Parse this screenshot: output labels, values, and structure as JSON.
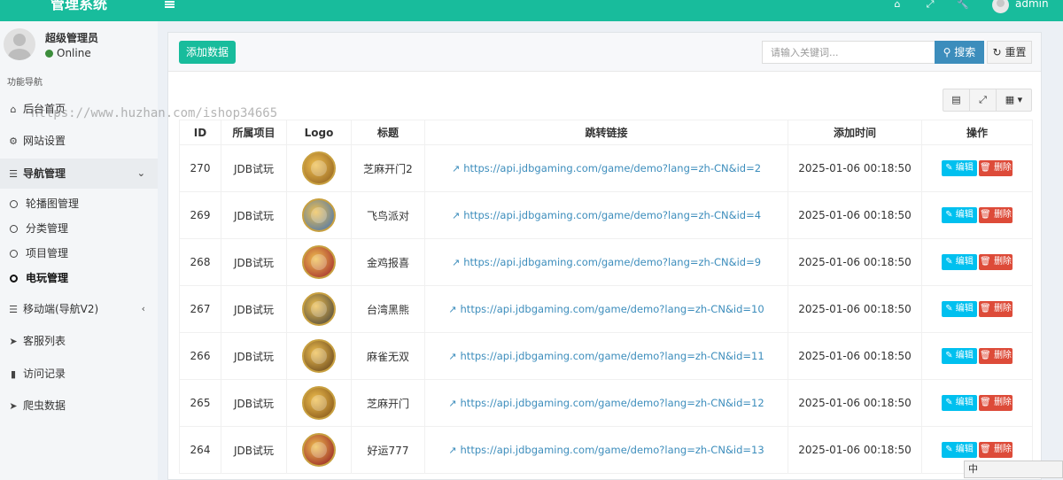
{
  "app": {
    "title": "管理系统"
  },
  "topbar": {
    "admin_name": "admin",
    "icons": [
      "home-icon",
      "expand-icon",
      "wrench-icon"
    ]
  },
  "sidebar": {
    "username": "超级管理员",
    "status": "Online",
    "section_header": "功能导航",
    "items": [
      {
        "label": "后台首页",
        "icon": "home-icon"
      },
      {
        "label": "网站设置",
        "icon": "cogs-icon"
      },
      {
        "label": "导航管理",
        "icon": "database-icon"
      },
      {
        "label": "移动端(导航V2)",
        "icon": "database-icon"
      },
      {
        "label": "客服列表",
        "icon": "tags-icon"
      },
      {
        "label": "访问记录",
        "icon": "bar-chart-icon"
      },
      {
        "label": "爬虫数据",
        "icon": "tags-icon"
      }
    ],
    "subitems": [
      "轮播图管理",
      "分类管理",
      "项目管理",
      "电玩管理"
    ]
  },
  "toolbar": {
    "add_label": "添加数据",
    "search_placeholder": "请输入关键词...",
    "search_label": "搜索",
    "reset_label": "重置"
  },
  "table": {
    "headers": [
      "ID",
      "所属项目",
      "Logo",
      "标题",
      "跳转链接",
      "添加时间",
      "操作"
    ],
    "edit_label": "编辑",
    "delete_label": "删除",
    "rows": [
      {
        "id": "270",
        "project": "JDB试玩",
        "title": "芝麻开门2",
        "link": "https://api.jdbgaming.com/game/demo?lang=zh-CN&id=2",
        "time": "2025-01-06 00:18:50",
        "logo_color": "#8a5a1c"
      },
      {
        "id": "269",
        "project": "JDB试玩",
        "title": "飞鸟派对",
        "link": "https://api.jdbgaming.com/game/demo?lang=zh-CN&id=4",
        "time": "2025-01-06 00:18:50",
        "logo_color": "#3a6fb8"
      },
      {
        "id": "268",
        "project": "JDB试玩",
        "title": "金鸡报喜",
        "link": "https://api.jdbgaming.com/game/demo?lang=zh-CN&id=9",
        "time": "2025-01-06 00:18:50",
        "logo_color": "#9c1c2a"
      },
      {
        "id": "267",
        "project": "JDB试玩",
        "title": "台湾黑熊",
        "link": "https://api.jdbgaming.com/game/demo?lang=zh-CN&id=10",
        "time": "2025-01-06 00:18:50",
        "logo_color": "#3b3b3b"
      },
      {
        "id": "266",
        "project": "JDB试玩",
        "title": "麻雀无双",
        "link": "https://api.jdbgaming.com/game/demo?lang=zh-CN&id=11",
        "time": "2025-01-06 00:18:50",
        "logo_color": "#5a3a18"
      },
      {
        "id": "265",
        "project": "JDB试玩",
        "title": "芝麻开门",
        "link": "https://api.jdbgaming.com/game/demo?lang=zh-CN&id=12",
        "time": "2025-01-06 00:18:50",
        "logo_color": "#7a4a12"
      },
      {
        "id": "264",
        "project": "JDB试玩",
        "title": "好运777",
        "link": "https://api.jdbgaming.com/game/demo?lang=zh-CN&id=13",
        "time": "2025-01-06 00:18:50",
        "logo_color": "#8e1020"
      }
    ]
  },
  "watermark": "https://www.huzhan.com/ishop34665",
  "ime": {
    "label": "中"
  },
  "colors": {
    "brand": "#18bc9c",
    "primary": "#3c8dbc",
    "info": "#00c0ef",
    "danger": "#dd4b39"
  }
}
